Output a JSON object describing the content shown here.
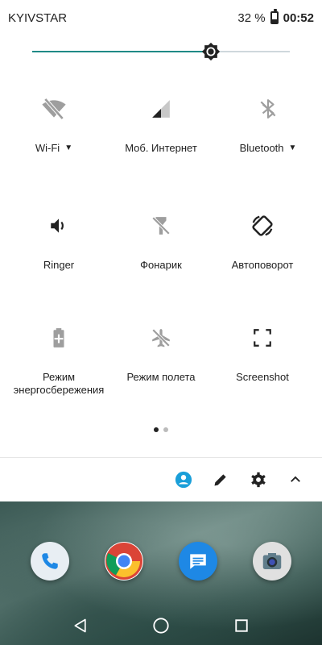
{
  "status_bar": {
    "carrier": "KYIVSTAR",
    "battery_percent": "32 %",
    "time": "00:52",
    "battery_level": 0.32
  },
  "brightness": {
    "level": 0.695
  },
  "tiles": [
    {
      "label": "Wi-Fi",
      "icon": "wifi-off-icon",
      "has_dropdown": true
    },
    {
      "label": "Моб. Интернет",
      "icon": "cellular-signal-icon",
      "has_dropdown": false
    },
    {
      "label": "Bluetooth",
      "icon": "bluetooth-off-icon",
      "has_dropdown": true
    },
    {
      "label": "Ringer",
      "icon": "volume-icon",
      "has_dropdown": false
    },
    {
      "label": "Фонарик",
      "icon": "flashlight-off-icon",
      "has_dropdown": false
    },
    {
      "label": "Автоповорот",
      "icon": "auto-rotate-icon",
      "has_dropdown": false
    },
    {
      "label": "Режим энергосбережения",
      "icon": "battery-saver-icon",
      "has_dropdown": false
    },
    {
      "label": "Режим полета",
      "icon": "airplane-mode-off-icon",
      "has_dropdown": false
    },
    {
      "label": "Screenshot",
      "icon": "screenshot-icon",
      "has_dropdown": false
    }
  ],
  "page_indicator": {
    "current": 1,
    "total": 2
  },
  "bottom_bar": {
    "icons": [
      "account-icon",
      "edit-icon",
      "settings-icon",
      "collapse-icon"
    ],
    "accent_color": "#1a9fd9"
  },
  "dock": {
    "apps": [
      "phone-icon",
      "chrome-icon",
      "messages-icon",
      "camera-icon"
    ]
  },
  "nav": {
    "buttons": [
      "back-icon",
      "home-icon",
      "recents-icon"
    ]
  },
  "colors": {
    "brightness_accent": "#1f8a86",
    "icon_gray": "#9e9e9e",
    "icon_dark": "#222222"
  }
}
